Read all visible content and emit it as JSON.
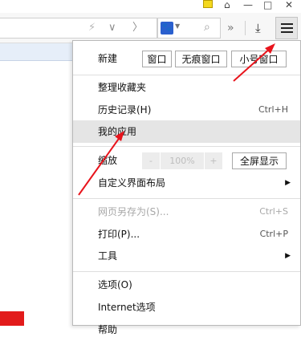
{
  "title_bar": {
    "home_icon": "⌂",
    "minimize_icon": "—",
    "maximize_icon": "□",
    "close_icon": "✕"
  },
  "toolbar": {
    "bolt_icon": "⚡",
    "down_icon": "∨",
    "right_icon": "〉",
    "search_engine_icon": "🐾",
    "search_caret_icon": "▼",
    "search_icon": "⌕",
    "more_icon": "»",
    "download_icon": "⤓"
  },
  "menu": {
    "new_row": {
      "label": "新建",
      "buttons": [
        "窗口",
        "无痕窗口",
        "小号窗口"
      ]
    },
    "items_a": [
      {
        "label": "整理收藏夹",
        "shortcut": ""
      },
      {
        "label": "历史记录(H)",
        "shortcut": "Ctrl+H"
      },
      {
        "label": "我的应用",
        "shortcut": "",
        "highlighted": true
      }
    ],
    "zoom": {
      "label": "缩放",
      "minus": "-",
      "value": "100%",
      "plus": "+",
      "fullscreen": "全屏显示"
    },
    "layout": {
      "label": "自定义界面布局",
      "arrow": "▶"
    },
    "items_b": [
      {
        "label": "网页另存为(S)...",
        "shortcut": "Ctrl+S",
        "disabled": true
      },
      {
        "label": "打印(P)...",
        "shortcut": "Ctrl+P"
      },
      {
        "label": "工具",
        "arrow": "▶"
      }
    ],
    "items_c": [
      {
        "label": "选项(O)"
      },
      {
        "label": "Internet选项"
      },
      {
        "label": "帮助"
      }
    ]
  },
  "colors": {
    "accent_arrow": "#e8141c",
    "highlight": "#e5e5e5"
  }
}
